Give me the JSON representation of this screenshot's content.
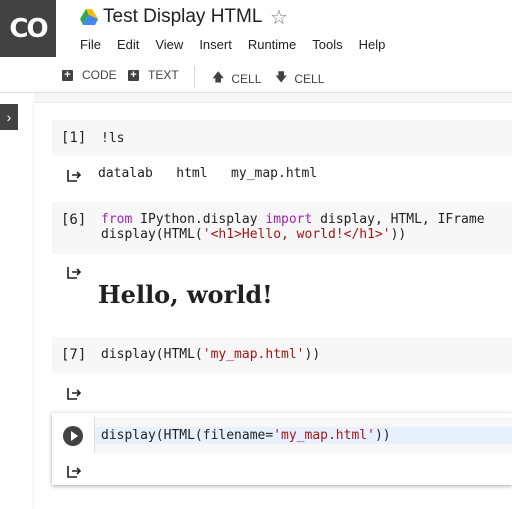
{
  "app": {
    "logo_text": "CO",
    "title": "Test Display HTML"
  },
  "menu": [
    "File",
    "Edit",
    "View",
    "Insert",
    "Runtime",
    "Tools",
    "Help"
  ],
  "toolbar": {
    "add_code": "CODE",
    "add_text": "TEXT",
    "cell_up": "CELL",
    "cell_down": "CELL"
  },
  "cells": [
    {
      "prompt": "[1]",
      "code": "!ls",
      "output": "datalab   html   my_map.html"
    },
    {
      "prompt": "[6]",
      "code_line1_a": "from",
      "code_line1_b": " IPython.display ",
      "code_line1_c": "import",
      "code_line1_d": " display, HTML, IFrame",
      "code_line2_a": "display(HTML(",
      "code_line2_b": "'<h1>Hello, world!</h1>'",
      "code_line2_c": "))",
      "output": "Hello, world!"
    },
    {
      "prompt": "[7]",
      "code_a": "display(HTML(",
      "code_b": "'my_map.html'",
      "code_c": "))"
    },
    {
      "code_a": "display(HTML(filename=",
      "code_b": "'my_map.html'",
      "code_c": "))"
    }
  ],
  "icons": {
    "star": "star-outline-icon",
    "drive": "google-drive-icon",
    "output": "output-arrow-icon",
    "run": "run-cell-icon"
  }
}
